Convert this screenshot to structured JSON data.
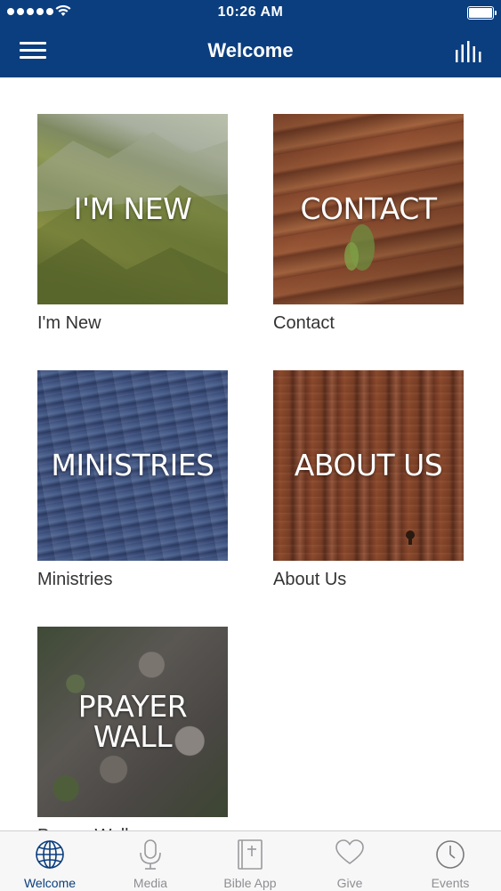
{
  "status_bar": {
    "time": "10:26 AM",
    "signal_dots": 5
  },
  "nav": {
    "title": "Welcome"
  },
  "tiles": [
    {
      "overlay": "I'M NEW",
      "caption": "I'm New"
    },
    {
      "overlay": "CONTACT",
      "caption": "Contact"
    },
    {
      "overlay": "MINISTRIES",
      "caption": "Ministries"
    },
    {
      "overlay": "ABOUT US",
      "caption": "About Us"
    },
    {
      "overlay": "PRAYER\nWALL",
      "caption": "Prayer Wall"
    }
  ],
  "tabs": [
    {
      "label": "Welcome",
      "icon": "globe-icon",
      "active": true
    },
    {
      "label": "Media",
      "icon": "microphone-icon",
      "active": false
    },
    {
      "label": "Bible App",
      "icon": "bible-icon",
      "active": false
    },
    {
      "label": "Give",
      "icon": "heart-icon",
      "active": false
    },
    {
      "label": "Events",
      "icon": "clock-icon",
      "active": false
    }
  ],
  "colors": {
    "brand": "#0b3e7e",
    "tab_active": "#0b3e7e",
    "tab_inactive": "#8e8e93"
  }
}
